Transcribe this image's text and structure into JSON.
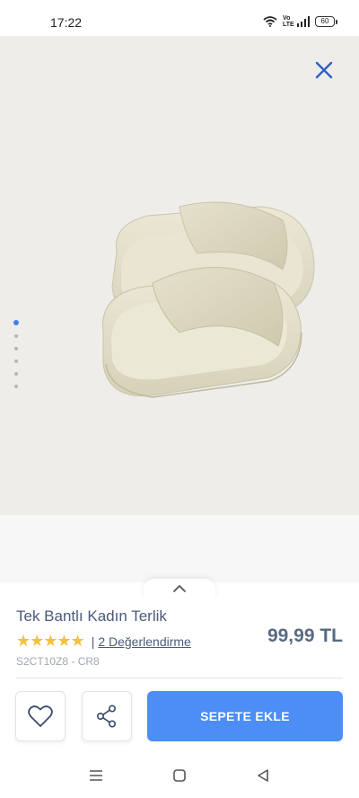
{
  "status_bar": {
    "time": "17:22",
    "network_label": "Vo LTE",
    "battery_level": "60"
  },
  "gallery": {
    "image_count": 6,
    "active_index": 0,
    "close_icon": "close-icon",
    "background_color": "#eeede9"
  },
  "product": {
    "title": "Tek Bantlı Kadın Terlik",
    "rating_stars": 5,
    "stars_text": "★★★★★",
    "separator": "|",
    "reviews_link": "2 Değerlendirme",
    "sku": "S2CT10Z8 - CR8",
    "price": "99,99 TL"
  },
  "actions": {
    "favorite_icon": "heart-icon",
    "share_icon": "share-icon",
    "add_to_cart_label": "SEPETE EKLE",
    "accent_color": "#4c8df6"
  },
  "nav": {
    "menu_icon": "menu-icon",
    "home_icon": "home-square-icon",
    "back_icon": "back-triangle-icon"
  }
}
